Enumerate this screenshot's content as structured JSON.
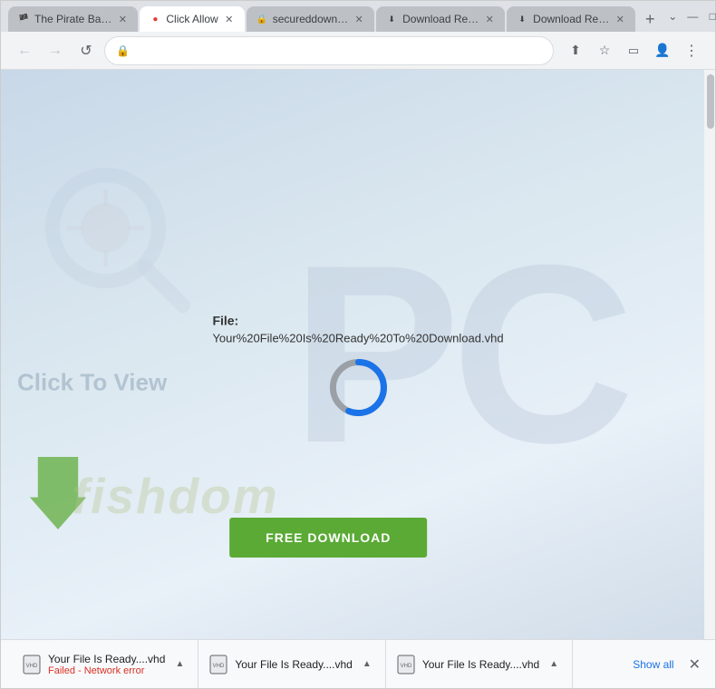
{
  "browser": {
    "tabs": [
      {
        "id": "tab1",
        "title": "The Pirate Ba…",
        "favicon": "🏴",
        "active": false,
        "closeable": true
      },
      {
        "id": "tab2",
        "title": "Click Allow",
        "favicon": "🔴",
        "active": true,
        "closeable": true
      },
      {
        "id": "tab3",
        "title": "secureddown…",
        "favicon": "🔒",
        "active": false,
        "closeable": true
      },
      {
        "id": "tab4",
        "title": "Download Re…",
        "favicon": "⬇",
        "active": false,
        "closeable": true
      },
      {
        "id": "tab5",
        "title": "Download Re…",
        "favicon": "⬇",
        "active": false,
        "closeable": true
      }
    ],
    "new_tab_label": "+",
    "window_controls": {
      "minimize": "—",
      "maximize": "□",
      "close": "✕"
    },
    "nav": {
      "back": "←",
      "forward": "→",
      "reload": "↺",
      "address": "",
      "lock_icon": "🔒"
    },
    "nav_action_icons": [
      "share",
      "star",
      "tablet",
      "person",
      "menu"
    ]
  },
  "page": {
    "watermark_pc": "PC",
    "watermark_fishdom": "fishdom",
    "click_to_view": "Click To View",
    "file_label": "File:",
    "file_name": "Your%20File%20Is%20Ready%20To%20Download.vhd",
    "download_btn_label": "FREE DOWNLOAD",
    "loading_ring": {
      "progress": 75,
      "color_active": "#1a73e8",
      "color_track": "#9aa0a6"
    }
  },
  "download_bar": {
    "items": [
      {
        "filename": "Your File Is Ready....vhd",
        "status": "Failed - Network error",
        "status_type": "error"
      },
      {
        "filename": "Your File Is Ready....vhd",
        "status": "",
        "status_type": "normal"
      },
      {
        "filename": "Your File Is Ready....vhd",
        "status": "",
        "status_type": "normal"
      }
    ],
    "show_all_label": "Show all",
    "close_label": "✕"
  }
}
